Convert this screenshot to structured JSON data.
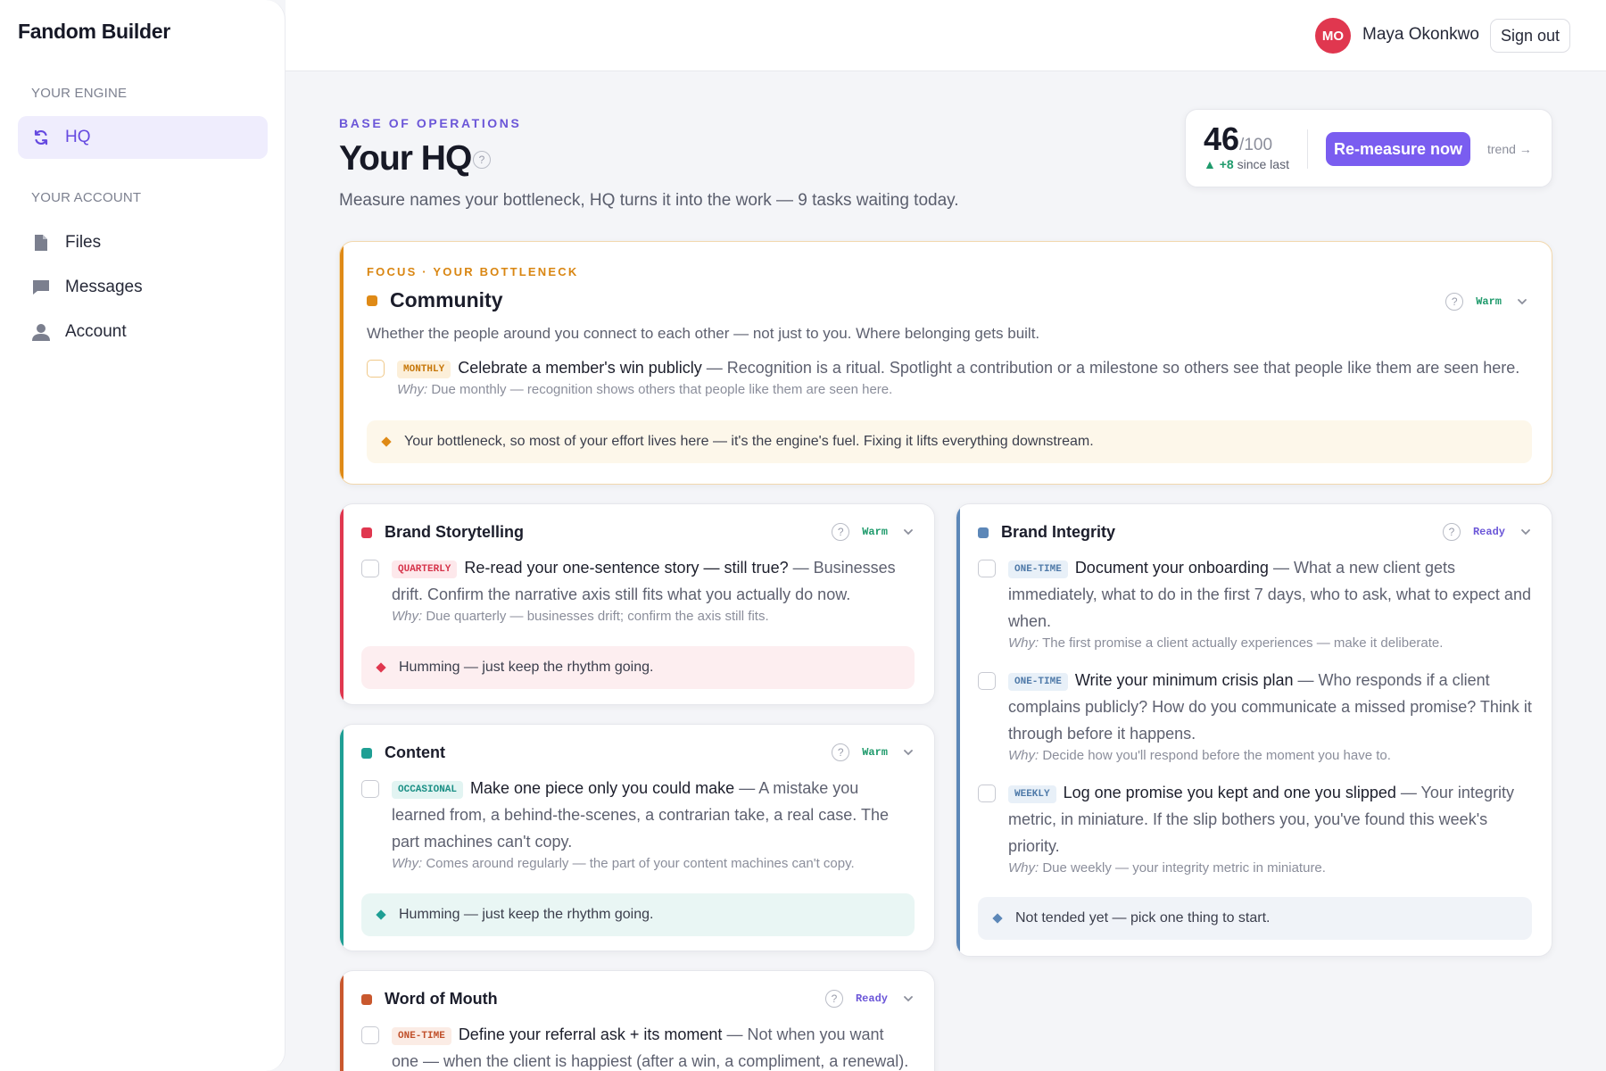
{
  "app": {
    "brand": "Fandom Builder"
  },
  "sidebar": {
    "engine_label": "YOUR ENGINE",
    "account_label": "YOUR ACCOUNT",
    "items": [
      {
        "label": "HQ",
        "icon": "refresh-icon"
      },
      {
        "label": "Files",
        "icon": "file-icon"
      },
      {
        "label": "Messages",
        "icon": "chat-icon"
      },
      {
        "label": "Account",
        "icon": "user-icon"
      }
    ]
  },
  "header": {
    "avatar_initials": "MO",
    "user_name": "Maya Okonkwo",
    "sign_out": "Sign out"
  },
  "page": {
    "eyebrow": "BASE OF OPERATIONS",
    "title": "Your HQ",
    "help": "?",
    "subtitle": "Measure names your bottleneck, HQ turns it into the work — 9 tasks waiting today."
  },
  "score": {
    "value": "46",
    "max": "/100",
    "delta_arrow": "▲",
    "delta_value": "+8",
    "delta_label": " since last",
    "button": "Re-measure now",
    "trend": "trend →"
  },
  "colors": {
    "accent": "#7a5df0",
    "community": "#df8a16",
    "storytelling": "#e0374f",
    "content": "#1f9f94",
    "word_of_mouth": "#c9582e",
    "integrity": "#5c87b8"
  },
  "focus": {
    "eyebrow": "FOCUS · YOUR BOTTLENECK",
    "title": "Community",
    "status": "Warm",
    "description": "Whether the people around you connect to each other — not just to you. Where belonging gets built.",
    "task": {
      "tag": "MONTHLY",
      "title": "Celebrate a member's win publicly",
      "desc": " — Recognition is a ritual. Spotlight a contribution or a milestone so others see that people like them are seen here.",
      "why_label": "Why:",
      "why": " Due monthly — recognition shows others that people like them are seen here."
    },
    "note": "Your bottleneck, so most of your effort lives here — it's the engine's fuel. Fixing it lifts everything downstream."
  },
  "storytelling": {
    "title": "Brand Storytelling",
    "status": "Warm",
    "task": {
      "tag": "QUARTERLY",
      "title": "Re-read your one-sentence story — still true?",
      "desc": " — Businesses drift. Confirm the narrative axis still fits what you actually do now.",
      "why_label": "Why:",
      "why": " Due quarterly — businesses drift; confirm the axis still fits."
    },
    "note": "Humming — just keep the rhythm going."
  },
  "content": {
    "title": "Content",
    "status": "Warm",
    "task": {
      "tag": "OCCASIONAL",
      "title": "Make one piece only you could make",
      "desc": " — A mistake you learned from, a behind-the-scenes, a contrarian take, a real case. The part machines can't copy.",
      "why_label": "Why:",
      "why": " Comes around regularly — the part of your content machines can't copy."
    },
    "note": "Humming — just keep the rhythm going."
  },
  "word_of_mouth": {
    "title": "Word of Mouth",
    "status": "Ready",
    "task": {
      "tag": "ONE-TIME",
      "title": "Define your referral ask + its moment",
      "desc": " — Not when you want one — when the client is happiest (after a win, a compliment, a renewal)."
    }
  },
  "integrity": {
    "title": "Brand Integrity",
    "status": "Ready",
    "tasks": [
      {
        "tag": "ONE-TIME",
        "title": "Document your onboarding",
        "desc": " — What a new client gets immediately, what to do in the first 7 days, who to ask, what to expect and when.",
        "why_label": "Why:",
        "why": " The first promise a client actually experiences — make it deliberate."
      },
      {
        "tag": "ONE-TIME",
        "title": "Write your minimum crisis plan",
        "desc": " — Who responds if a client complains publicly? How do you communicate a missed promise? Think it through before it happens.",
        "why_label": "Why:",
        "why": " Decide how you'll respond before the moment you have to."
      },
      {
        "tag": "WEEKLY",
        "title": "Log one promise you kept and one you slipped",
        "desc": " — Your integrity metric, in miniature. If the slip bothers you, you've found this week's priority.",
        "why_label": "Why:",
        "why": " Due weekly — your integrity metric in miniature."
      }
    ],
    "note": "Not tended yet — pick one thing to start."
  }
}
